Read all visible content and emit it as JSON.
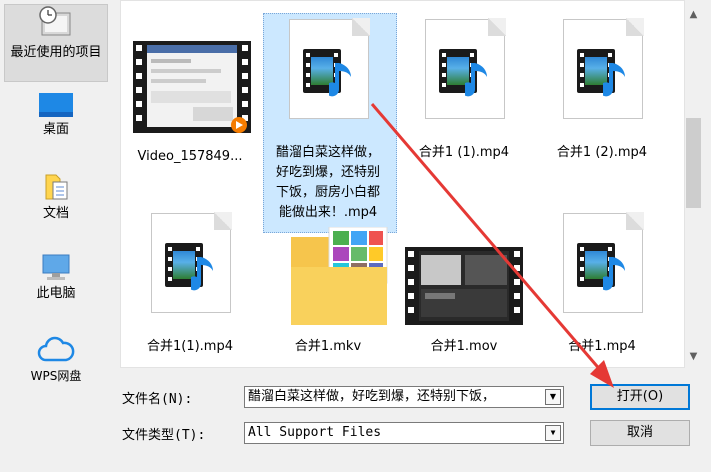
{
  "sidebar": {
    "items": [
      {
        "label": "最近使用的项目",
        "icon": "recent-items-icon"
      },
      {
        "label": "桌面",
        "icon": "desktop-icon"
      },
      {
        "label": "文档",
        "icon": "documents-icon"
      },
      {
        "label": "此电脑",
        "icon": "this-pc-icon"
      },
      {
        "label": "WPS网盘",
        "icon": "wps-cloud-icon"
      }
    ]
  },
  "files": [
    {
      "name": "Video_157849...",
      "kind": "video-thumbnail"
    },
    {
      "name": "醋溜白菜这样做，好吃到爆，还特别下饭，厨房小白都能做出来！.mp4",
      "kind": "media-file",
      "selected": true
    },
    {
      "name": "合并1 (1).mp4",
      "kind": "media-file"
    },
    {
      "name": "合并1 (2).mp4",
      "kind": "media-file"
    },
    {
      "name": "合并1(1).mp4",
      "kind": "media-file"
    },
    {
      "name": "合并1.mkv",
      "kind": "folder-with-images"
    },
    {
      "name": "合并1.mov",
      "kind": "video-thumbnail"
    },
    {
      "name": "合并1.mp4",
      "kind": "media-file"
    }
  ],
  "selected_label_lines": [
    "醋溜白菜这样做，",
    "好吃到爆，还特别",
    "下饭，厨房小白都",
    "能做出来！.mp4"
  ],
  "form": {
    "filename_label": "文件名(N):",
    "filename_value": "醋溜白菜这样做，好吃到爆，还特别下饭，",
    "filetype_label": "文件类型(T):",
    "filetype_value": "All Support Files"
  },
  "buttons": {
    "open": "打开(O)",
    "cancel": "取消"
  },
  "colors": {
    "selection": "#cce8ff",
    "annotation_arrow": "#e53935",
    "default_button_border": "#0078d7"
  }
}
